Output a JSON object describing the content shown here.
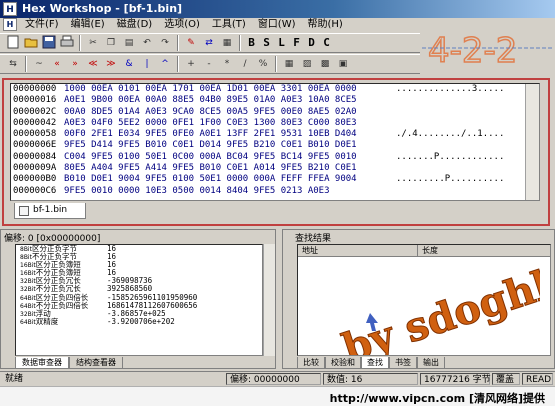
{
  "window": {
    "title": "Hex Workshop - [bf-1.bin]",
    "app_icon": "hex-icon"
  },
  "menu": [
    "文件(F)",
    "编辑(E)",
    "磁盘(D)",
    "选项(O)",
    "工具(T)",
    "窗口(W)",
    "帮助(H)"
  ],
  "toolbar1": {
    "letters": [
      "B",
      "S",
      "L",
      "F",
      "D",
      "C"
    ]
  },
  "logo_text": "4-2-2",
  "hex": {
    "rows": [
      {
        "offset": "00000000",
        "hex": "1000 00EA 0101 00EA 1701 00EA 1D01 00EA 3301 00EA 0000",
        "ascii": "..............3....."
      },
      {
        "offset": "00000016",
        "hex": "A0E1 9B00 00EA 00A0 88E5 04B0 89E5 01A0 A0E3 10A0 8CE5",
        "ascii": ""
      },
      {
        "offset": "0000002C",
        "hex": "00A0 8DE5 01A4 A0E3 9CA0 8CE5 00A5 9FE5 00E0 8AE5 02A0",
        "ascii": ""
      },
      {
        "offset": "00000042",
        "hex": "A0E3 04F0 5EE2 0000 0FE1 1F00 C0E3 1300 80E3 C000 80E3",
        "ascii": ""
      },
      {
        "offset": "00000058",
        "hex": "00F0 2FE1 E034 9FE5 0FE0 A0E1 13FF 2FE1 9531 10EB D404",
        "ascii": "./.4......../..1...."
      },
      {
        "offset": "0000006E",
        "hex": "9FE5 D414 9FE5 B010 C0E1 D014 9FE5 B210 C0E1 B010 D0E1",
        "ascii": ""
      },
      {
        "offset": "00000084",
        "hex": "C004 9FE5 0100 50E1 0C00 000A BC04 9FE5 BC14 9FE5 0010",
        "ascii": ".......P............"
      },
      {
        "offset": "0000009A",
        "hex": "80E5 A404 9FE5 A414 9FE5 B010 C0E1 A014 9FE5 B210 C0E1",
        "ascii": ""
      },
      {
        "offset": "000000B0",
        "hex": "B010 D0E1 9004 9FE5 0100 50E1 0000 000A FEFF FFEA 9004",
        "ascii": ".........P.........."
      },
      {
        "offset": "000000C6",
        "hex": "9FE5 0010 0000 10E3 0500 0014 8404 9FE5 0213 A0E3",
        "ascii": ""
      }
    ]
  },
  "file_tab": "bf-1.bin",
  "interpreter": {
    "header": "偏移: 0 [0x00000000]",
    "rows": [
      {
        "bits": "8Bit",
        "label": "区分正负字节",
        "value": "16"
      },
      {
        "bits": "8Bit",
        "label": "不分正负字节",
        "value": "16"
      },
      {
        "bits": "16Bit",
        "label": "区分正负簿短",
        "value": "16"
      },
      {
        "bits": "16Bit",
        "label": "不分正负簿短",
        "value": "16"
      },
      {
        "bits": "32Bit",
        "label": "区分正负冗长",
        "value": "-369098736"
      },
      {
        "bits": "32Bit",
        "label": "不分正负冗长",
        "value": "3925868560"
      },
      {
        "bits": "64Bit",
        "label": "区分正负四倍长",
        "value": "-1585265961101950960"
      },
      {
        "bits": "64Bit",
        "label": "不分正负四倍长",
        "value": "16861478112607600656"
      },
      {
        "bits": "32Bit",
        "label": "浮动",
        "value": "-3.86857e+025"
      },
      {
        "bits": "64Bit",
        "label": "双精度",
        "value": "-3.9200706e+202"
      },
      {
        "bits": "",
        "label": "",
        "value": ""
      },
      {
        "bits": "",
        "label": "",
        "value": ""
      },
      {
        "bits": "",
        "label": "",
        "value": ""
      }
    ],
    "tabs": [
      "数据审查器",
      "结构查看器"
    ]
  },
  "results": {
    "header": "查找结果",
    "columns": [
      "地址",
      "长度"
    ],
    "watermark": "by sdoghb",
    "tabs": [
      "比较",
      "校验和",
      "查找",
      "书签",
      "输出"
    ]
  },
  "status": {
    "ready": "就绪",
    "offset_label": "偏移:",
    "offset_value": "00000000",
    "value_label": "数值:",
    "value_value": "16",
    "size": "16777216 字节",
    "mode_ovr": "覆盖",
    "mode": "READ"
  },
  "footer": {
    "credit": "http://www.vipcn.com [清风网络]提供"
  }
}
